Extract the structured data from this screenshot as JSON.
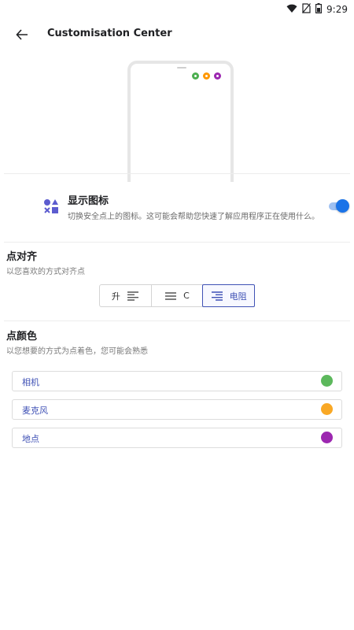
{
  "status_bar": {
    "time": "9:29",
    "icons": [
      "wifi-icon",
      "sim-off-icon",
      "battery-icon"
    ]
  },
  "app_bar": {
    "back_icon": "arrow-back-icon",
    "title": "Customisation Center"
  },
  "preview": {
    "dots": [
      {
        "name": "camera",
        "color": "#4caf50"
      },
      {
        "name": "microphone",
        "color": "#ff9800"
      },
      {
        "name": "location",
        "color": "#9c27b0"
      }
    ]
  },
  "show_icon": {
    "icon": "shapes-icon",
    "title": "显示图标",
    "subtitle": "切换安全点上的图标。这可能会帮助您快速了解应用程序正在使用什么。",
    "enabled": true,
    "accent": "#1a73e8"
  },
  "alignment": {
    "title": "点对齐",
    "subtitle": "以您喜欢的方式对齐点",
    "options": [
      {
        "label": "升",
        "icon": "align-left-icon",
        "selected": false
      },
      {
        "label": "C",
        "icon": "align-center-icon",
        "selected": false
      },
      {
        "label": "电阻",
        "icon": "align-right-icon",
        "selected": true
      }
    ],
    "selected_color": "#3f51b5"
  },
  "dot_colors": {
    "title": "点颜色",
    "subtitle": "以您想要的方式为点着色，您可能会熟悉",
    "items": [
      {
        "label": "相机",
        "color": "#5cb85c"
      },
      {
        "label": "麦克风",
        "color": "#f9a825"
      },
      {
        "label": "地点",
        "color": "#9c27b0"
      }
    ]
  }
}
